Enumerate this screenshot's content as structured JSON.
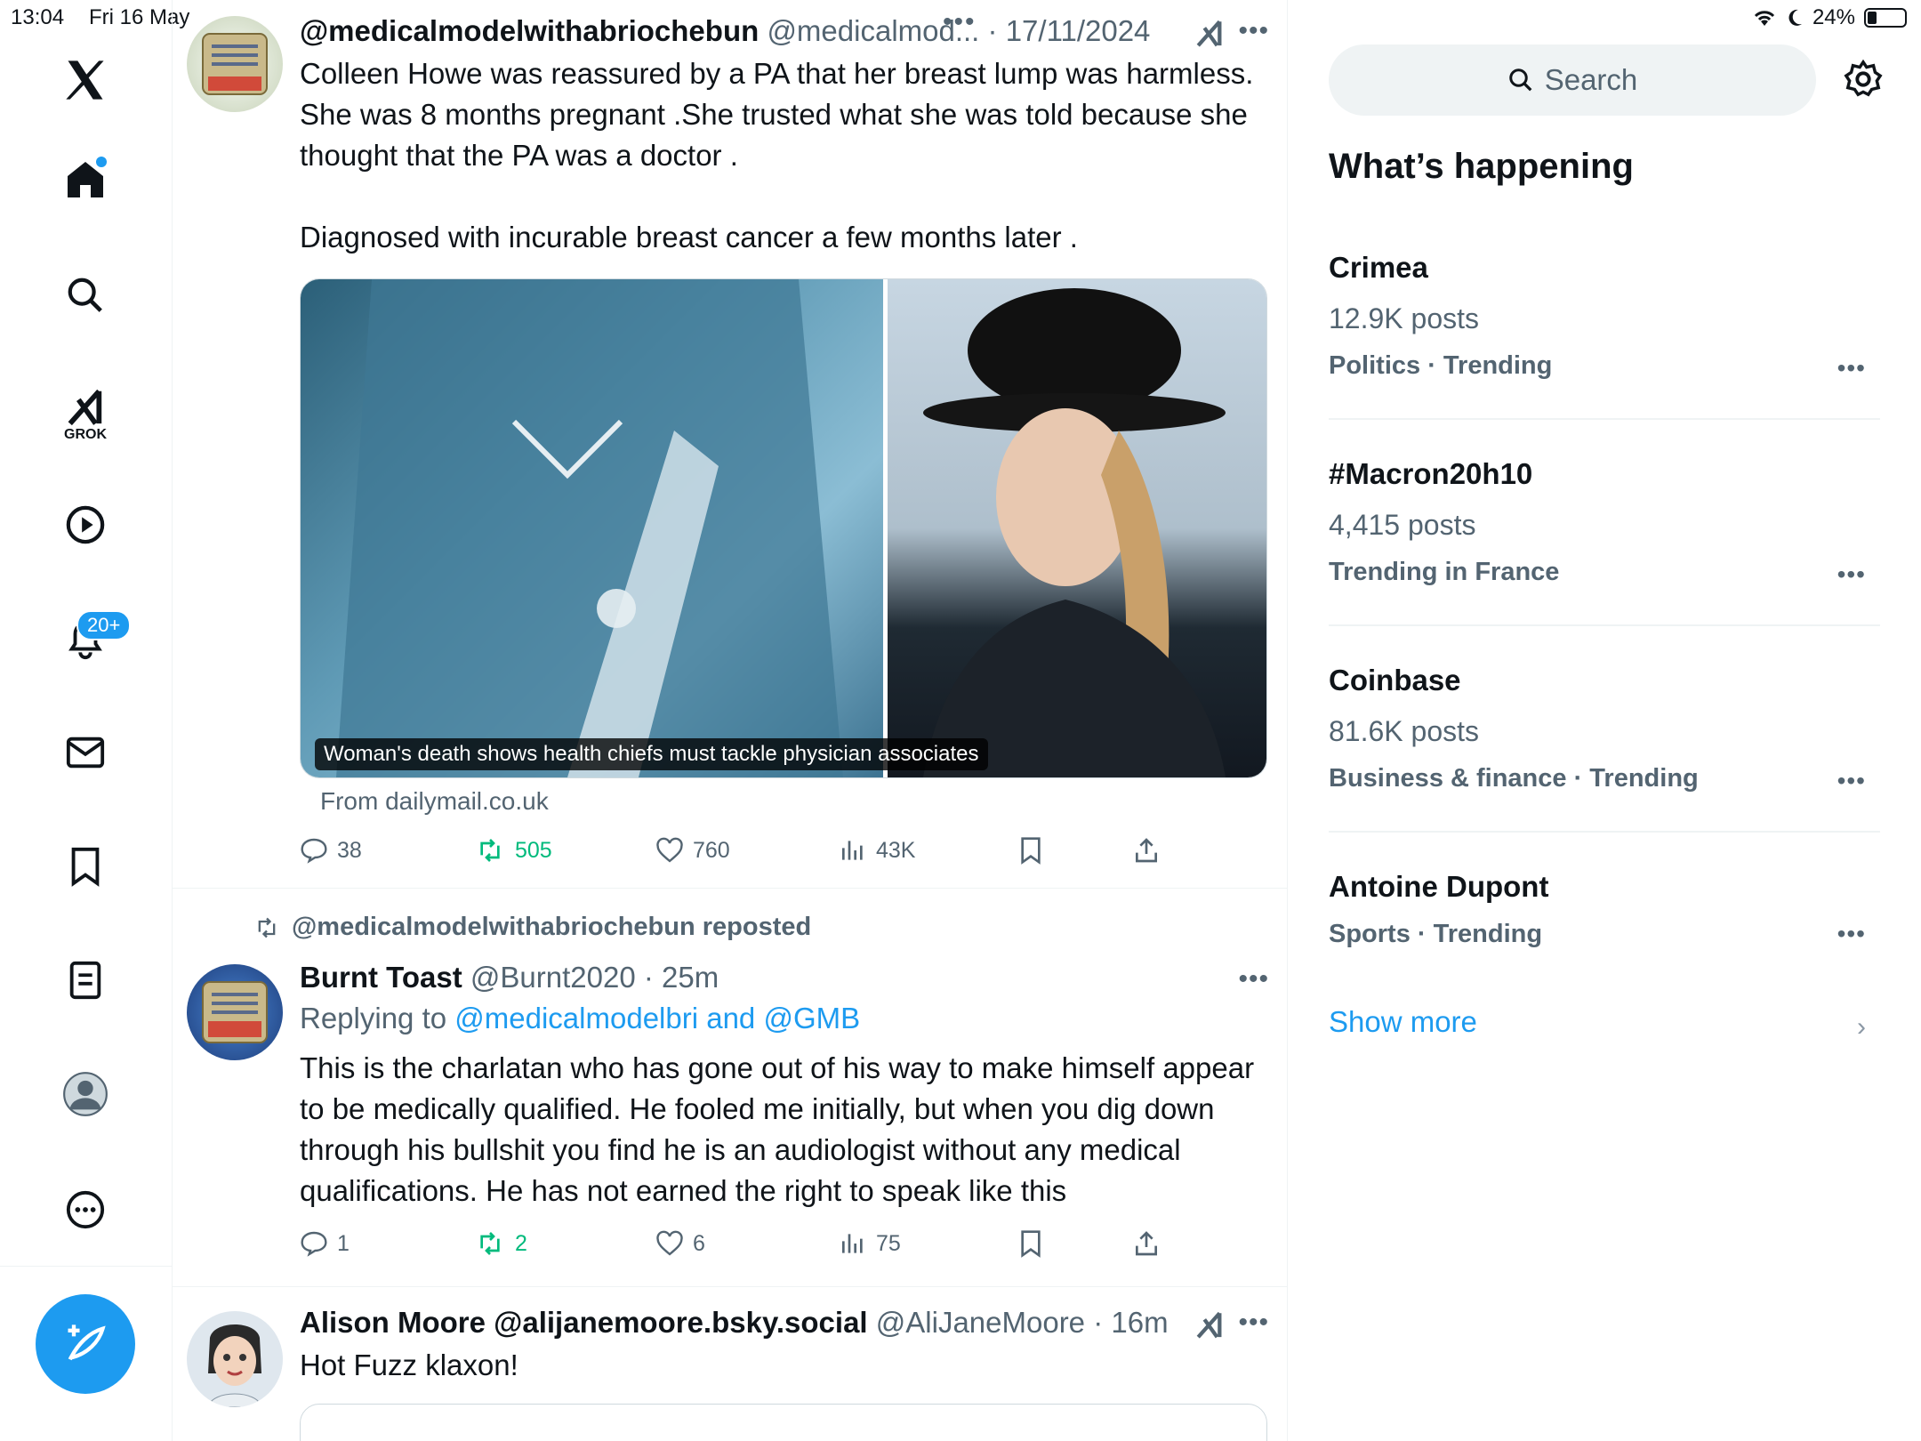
{
  "status": {
    "time": "13:04",
    "date": "Fri 16 May",
    "battery": "24%"
  },
  "nav": {
    "grok_label": "GROK",
    "notifications_badge": "20+"
  },
  "tweets": [
    {
      "handle_bold": "@medicalmodelwithabriochebun",
      "handle": "@medicalmod...",
      "time": "17/11/2024",
      "text1": "Colleen Howe was reassured by a PA that her breast lump was harmless. She was 8 months pregnant .She trusted what she was told because she thought that the PA was a doctor .",
      "text2": "Diagnosed with incurable breast cancer a few months later .",
      "media_caption": "Woman's death shows health chiefs must tackle physician associates",
      "source": "From dailymail.co.uk",
      "replies": "38",
      "reposts": "505",
      "likes": "760",
      "views": "43K"
    },
    {
      "repost_label": "@medicalmodelwithabriochebun reposted",
      "name": "Burnt Toast",
      "handle": "@Burnt2020",
      "time": "25m",
      "replying_prefix": "Replying to",
      "replying_to": "@medicalmodelbri and @GMB",
      "text": "This is the charlatan who has gone out of his way to make himself appear to be medically qualified. He fooled me initially, but when you dig down through his bullshit you find he is an audiologist without any medical qualifications. He has not earned the right to speak like this",
      "replies": "1",
      "reposts": "2",
      "likes": "6",
      "views": "75"
    },
    {
      "name": "Alison Moore @alijanemoore.bsky.social",
      "handle": "@AliJaneMoore",
      "time": "16m",
      "text": "Hot Fuzz klaxon!"
    }
  ],
  "sidebar": {
    "search_placeholder": "Search",
    "heading": "What’s happening",
    "trends": [
      {
        "title": "Crimea",
        "count": "12.9K posts",
        "category": "Politics · Trending"
      },
      {
        "title": "#Macron20h10",
        "count": "4,415 posts",
        "category": "Trending in France"
      },
      {
        "title": "Coinbase",
        "count": "81.6K posts",
        "category": "Business & finance · Trending"
      },
      {
        "title": "Antoine Dupont",
        "category": "Sports · Trending"
      }
    ],
    "show_more": "Show more"
  },
  "colors": {
    "accent": "#1d9bf0",
    "repost_green": "#00ba7c",
    "muted": "#536471"
  }
}
